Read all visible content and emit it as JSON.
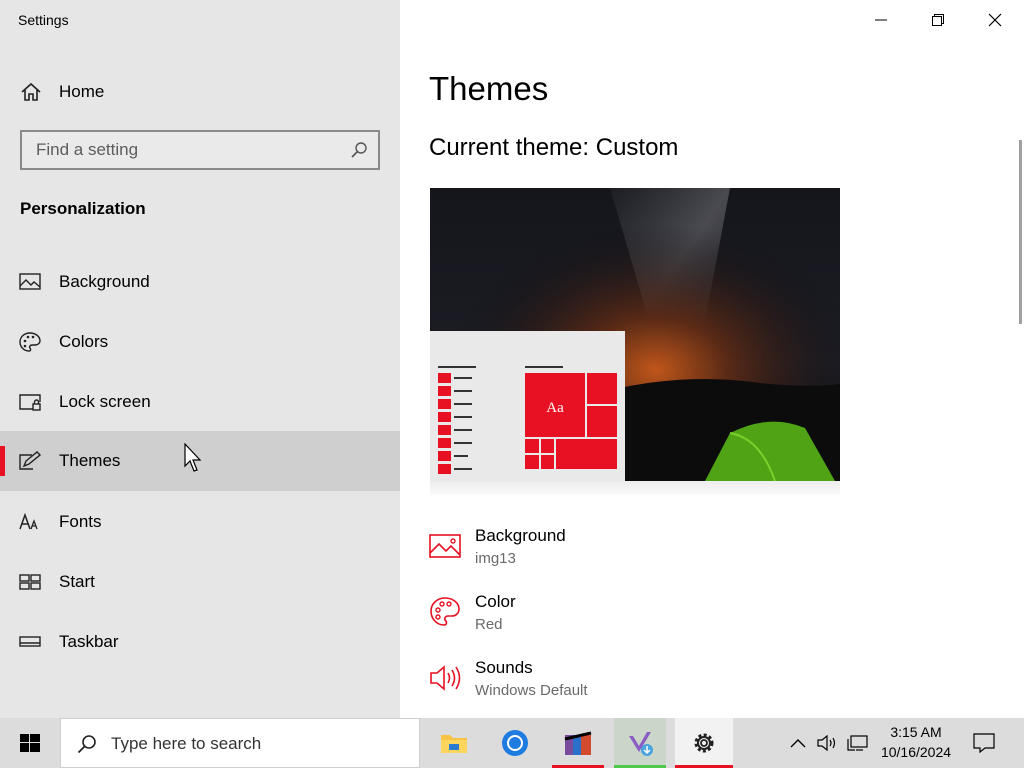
{
  "window": {
    "title": "Settings",
    "controls": [
      "minimize",
      "maximize",
      "close"
    ]
  },
  "sidebar": {
    "home_label": "Home",
    "search": {
      "placeholder": "Find a setting"
    },
    "section_title": "Personalization",
    "items": [
      {
        "label": "Background",
        "icon": "picture-icon",
        "active": false
      },
      {
        "label": "Colors",
        "icon": "palette-icon",
        "active": false
      },
      {
        "label": "Lock screen",
        "icon": "lock-screen-icon",
        "active": false
      },
      {
        "label": "Themes",
        "icon": "themes-icon",
        "active": true
      },
      {
        "label": "Fonts",
        "icon": "fonts-icon",
        "active": false
      },
      {
        "label": "Start",
        "icon": "start-icon",
        "active": false
      },
      {
        "label": "Taskbar",
        "icon": "taskbar-icon",
        "active": false
      }
    ]
  },
  "main": {
    "title": "Themes",
    "current_theme": "Current theme: Custom",
    "preview": {
      "tile_text": "Aa",
      "accent": "#e81123"
    },
    "settings": [
      {
        "name": "Background",
        "value": "img13",
        "icon": "picture-icon"
      },
      {
        "name": "Color",
        "value": "Red",
        "icon": "palette-icon"
      },
      {
        "name": "Sounds",
        "value": "Windows Default",
        "icon": "speaker-icon"
      }
    ]
  },
  "taskbar": {
    "search_placeholder": "Type here to search",
    "apps": [
      {
        "name": "File Explorer",
        "icon": "folder-icon",
        "underline": "none"
      },
      {
        "name": "Chrome",
        "icon": "chrome-icon",
        "underline": "none"
      },
      {
        "name": "Archive manager",
        "icon": "archive-icon",
        "underline": "#e81123"
      },
      {
        "name": "Visual Studio Installer",
        "icon": "visual-studio-icon",
        "underline": "#4cc94c",
        "highlighted": true
      },
      {
        "name": "Settings",
        "icon": "gear-icon",
        "underline": "#e81123",
        "active": true
      }
    ],
    "tray": {
      "time": "3:15 AM",
      "date": "10/16/2024"
    }
  },
  "colors": {
    "accent": "#e81123",
    "sidebar_bg": "#e6e6e6",
    "active_item_bg": "#cfcfcf",
    "taskbar_bg": "#dcdcdc"
  }
}
